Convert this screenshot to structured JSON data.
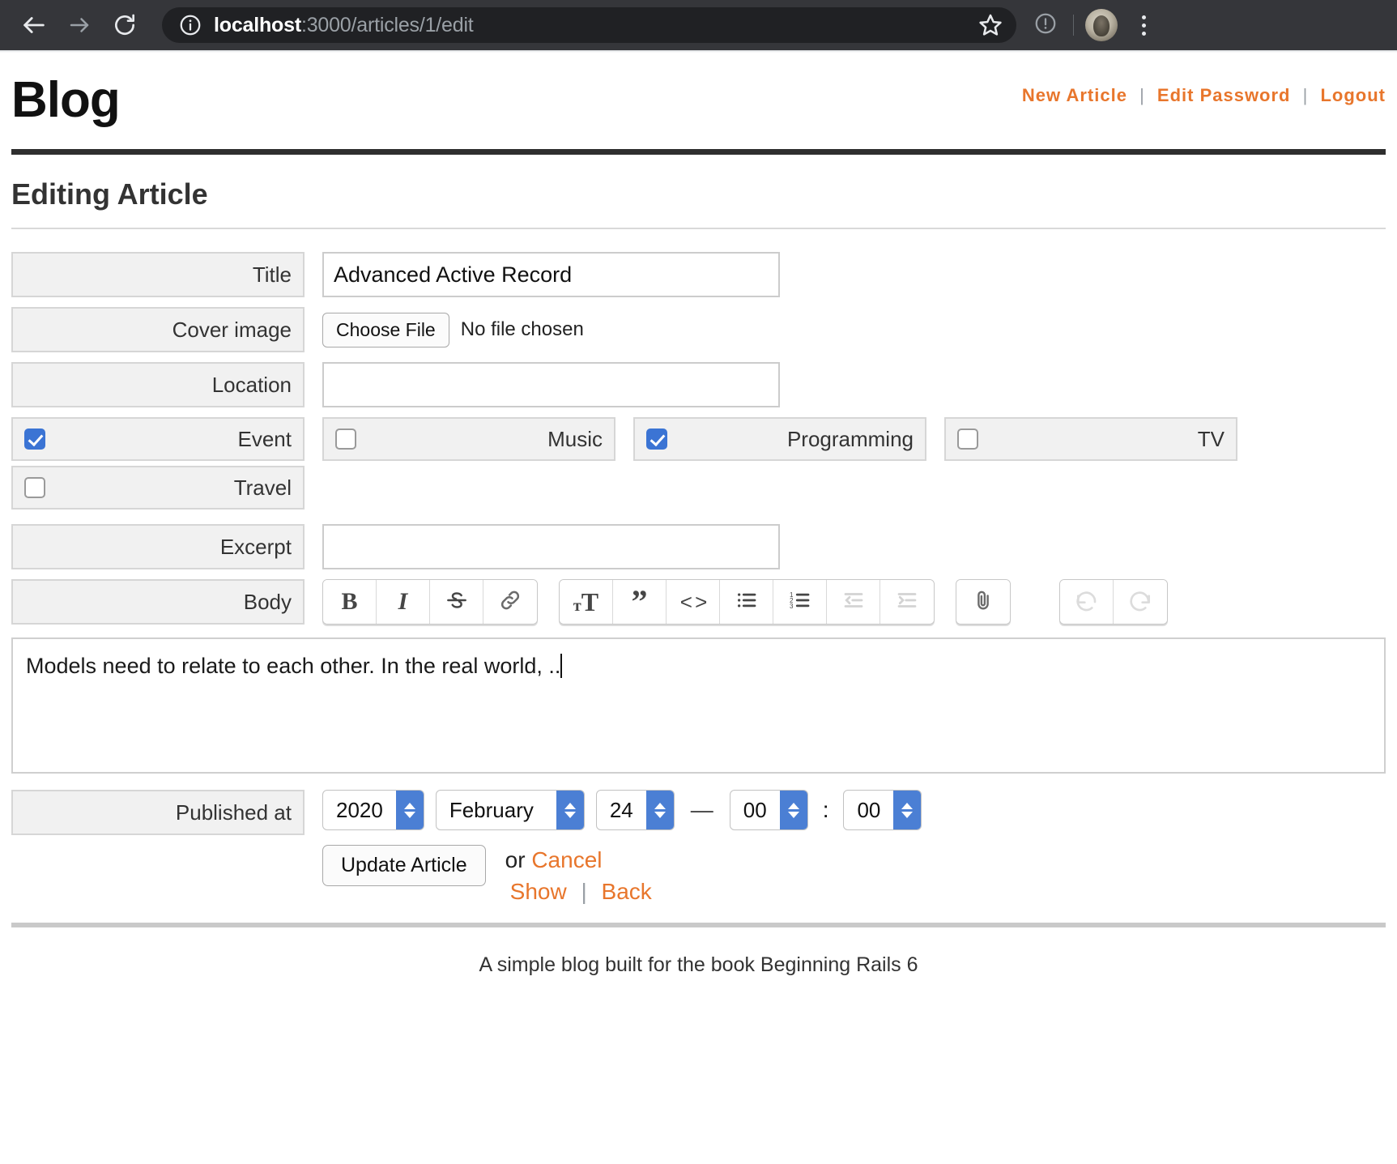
{
  "browser": {
    "back_icon": "arrow-left-icon",
    "forward_icon": "arrow-right-icon",
    "reload_icon": "reload-icon",
    "site_info_icon": "info-circle-icon",
    "url_host": "localhost",
    "url_path": ":3000/articles/1/edit",
    "bookmark_icon": "star-icon",
    "update_icon": "update-circle-icon",
    "profile_icon": "avatar",
    "menu_icon": "kebab-menu-icon"
  },
  "header": {
    "brand": "Blog",
    "nav": [
      {
        "label": "New Article"
      },
      {
        "label": "Edit Password"
      },
      {
        "label": "Logout"
      }
    ],
    "separator": "|"
  },
  "page": {
    "title": "Editing Article"
  },
  "form": {
    "title": {
      "label": "Title",
      "value": "Advanced Active Record",
      "placeholder": ""
    },
    "cover_image": {
      "label": "Cover image",
      "button": "Choose File",
      "status": "No file chosen"
    },
    "location": {
      "label": "Location",
      "value": "",
      "placeholder": ""
    },
    "categories": [
      {
        "label": "Event",
        "checked": true
      },
      {
        "label": "Music",
        "checked": false
      },
      {
        "label": "Programming",
        "checked": true
      },
      {
        "label": "TV",
        "checked": false
      },
      {
        "label": "Travel",
        "checked": false
      }
    ],
    "excerpt": {
      "label": "Excerpt",
      "value": "",
      "placeholder": ""
    },
    "body": {
      "label": "Body",
      "value": "Models need to relate to each other. In the real world, ..",
      "toolbar": [
        {
          "name": "bold-icon",
          "glyph": "B",
          "disabled": false
        },
        {
          "name": "italic-icon",
          "glyph": "I",
          "disabled": false
        },
        {
          "name": "strikethrough-icon",
          "glyph": "S",
          "disabled": false
        },
        {
          "name": "link-icon",
          "glyph": "link",
          "disabled": false
        },
        {
          "name": "heading-icon",
          "glyph": "TT",
          "disabled": false
        },
        {
          "name": "quote-icon",
          "glyph": "”",
          "disabled": false
        },
        {
          "name": "code-icon",
          "glyph": "<>",
          "disabled": false
        },
        {
          "name": "bullet-list-icon",
          "glyph": "ul",
          "disabled": false
        },
        {
          "name": "numbered-list-icon",
          "glyph": "ol",
          "disabled": false
        },
        {
          "name": "decrease-indent-icon",
          "glyph": "outdent",
          "disabled": true
        },
        {
          "name": "increase-indent-icon",
          "glyph": "indent",
          "disabled": true
        },
        {
          "name": "attach-file-icon",
          "glyph": "paperclip",
          "disabled": false
        },
        {
          "name": "undo-icon",
          "glyph": "undo",
          "disabled": true
        },
        {
          "name": "redo-icon",
          "glyph": "redo",
          "disabled": true
        }
      ]
    },
    "published_at": {
      "label": "Published at",
      "year": "2020",
      "month": "February",
      "day": "24",
      "date_time_separator": "—",
      "hour": "00",
      "time_separator": ":",
      "minute": "00"
    },
    "actions": {
      "submit": "Update Article",
      "or": "or",
      "cancel": "Cancel",
      "show": "Show",
      "separator": "|",
      "back": "Back"
    }
  },
  "footer": {
    "text": "A simple blog built for the book Beginning Rails 6"
  },
  "colors": {
    "accent_orange": "#e8762c",
    "checkbox_blue": "#3b74d4",
    "stepper_blue": "#4b7fd4",
    "chrome_bg": "#35363a",
    "omnibox_bg": "#202124"
  }
}
